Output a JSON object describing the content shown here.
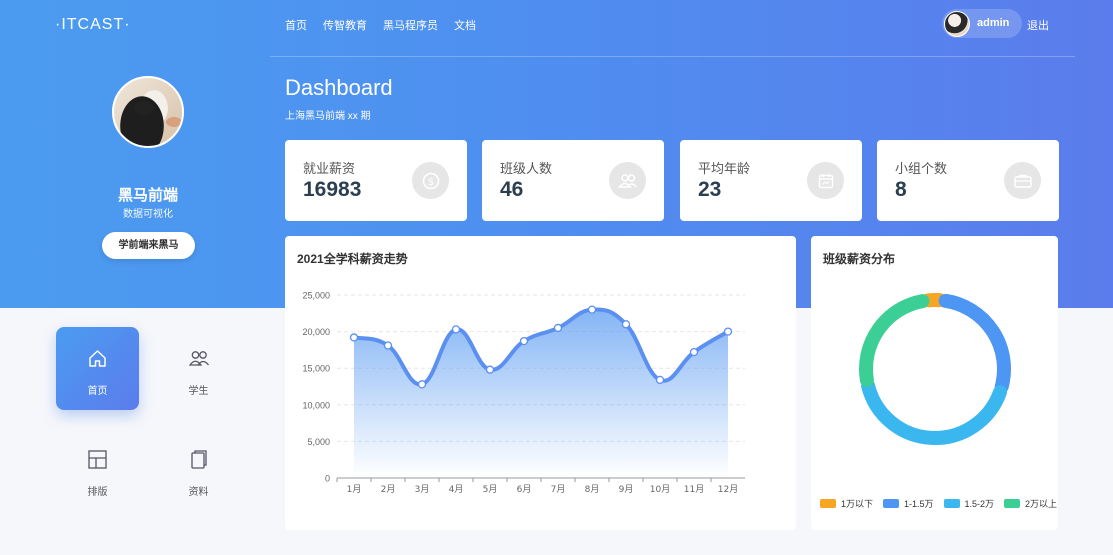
{
  "header": {
    "logo": "·ITCAST·",
    "nav": [
      "首页",
      "传智教育",
      "黑马程序员",
      "文档"
    ],
    "user": {
      "name": "admin",
      "logout": "退出"
    }
  },
  "profile": {
    "name": "黑马前端",
    "subtitle": "数据可视化",
    "button": "学前端来黑马"
  },
  "dashboard": {
    "title": "Dashboard",
    "subtitle": "上海黑马前端 xx 期"
  },
  "stats": [
    {
      "label": "就业薪资",
      "value": "16983",
      "icon": "money-icon"
    },
    {
      "label": "班级人数",
      "value": "46",
      "icon": "users-icon"
    },
    {
      "label": "平均年龄",
      "value": "23",
      "icon": "calendar-icon"
    },
    {
      "label": "小组个数",
      "value": "8",
      "icon": "briefcase-icon"
    }
  ],
  "menu": [
    {
      "label": "首页",
      "icon": "home-icon",
      "active": true
    },
    {
      "label": "学生",
      "icon": "students-icon",
      "active": false
    },
    {
      "label": "排版",
      "icon": "layout-icon",
      "active": false
    },
    {
      "label": "资料",
      "icon": "documents-icon",
      "active": false
    }
  ],
  "chart_data": [
    {
      "type": "line",
      "title": "2021全学科薪资走势",
      "categories": [
        "1月",
        "2月",
        "3月",
        "4月",
        "5月",
        "6月",
        "7月",
        "8月",
        "9月",
        "10月",
        "11月",
        "12月"
      ],
      "series": [
        {
          "values": [
            19200,
            18100,
            12800,
            20300,
            14800,
            18700,
            20500,
            23000,
            21000,
            13400,
            17200,
            20000
          ]
        }
      ],
      "yticks": [
        "0",
        "5,000",
        "10,000",
        "15,000",
        "20,000",
        "25,000"
      ],
      "ylim": [
        0,
        25000
      ],
      "smooth": true,
      "area": true,
      "grid": true,
      "line_color": "#5b8ff0"
    },
    {
      "type": "pie",
      "style": "donut",
      "title": "班级薪资分布",
      "categories": [
        "1万以下",
        "1-1.5万",
        "1.5-2万",
        "2万以上"
      ],
      "values": [
        4,
        28,
        42,
        26
      ],
      "colors": [
        "#f6a623",
        "#4d96f4",
        "#3bb7f0",
        "#3ccf95"
      ],
      "legend": "bottom"
    }
  ]
}
